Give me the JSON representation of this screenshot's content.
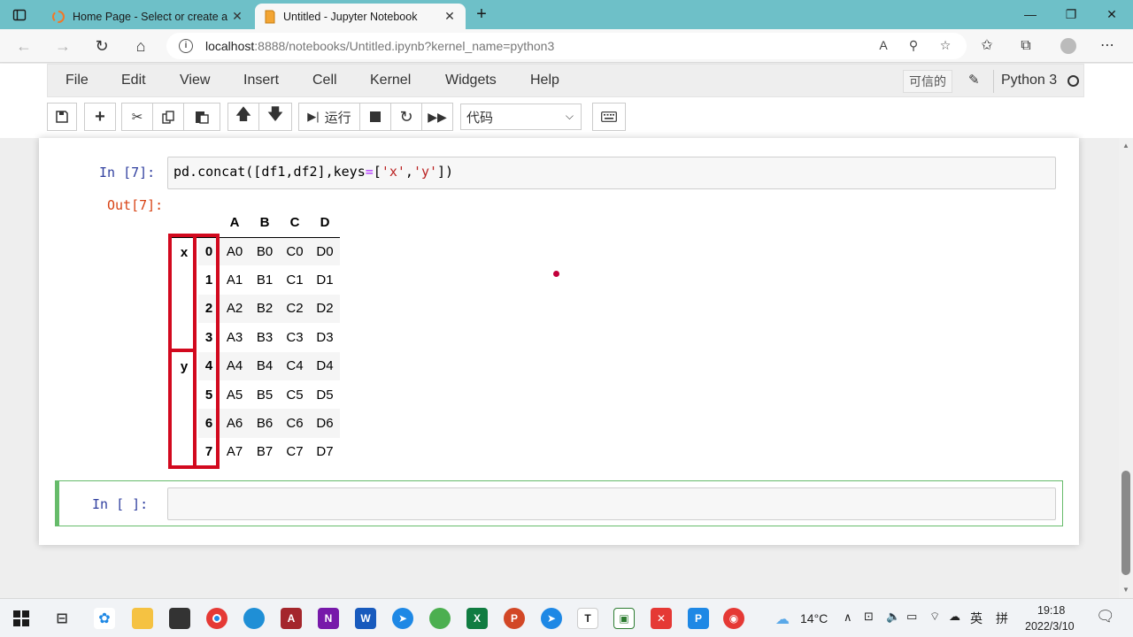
{
  "browser": {
    "tabs": [
      {
        "title": "Home Page - Select or create a n",
        "active": false
      },
      {
        "title": "Untitled - Jupyter Notebook",
        "active": true
      }
    ],
    "url_host": "localhost",
    "url_rest": ":8888/notebooks/Untitled.ipynb?kernel_name=python3"
  },
  "menu": [
    "File",
    "Edit",
    "View",
    "Insert",
    "Cell",
    "Kernel",
    "Widgets",
    "Help"
  ],
  "header": {
    "trusted_label": "可信的",
    "kernel_name": "Python 3"
  },
  "toolbar": {
    "run_label": "运行",
    "cell_type": "代码"
  },
  "cells": {
    "in7_prompt": "In  [7]:",
    "in7_code": {
      "fn": "pd.concat",
      "open": "([df1,df2],",
      "kw": "keys",
      "eq": "=",
      "lb": "[",
      "s1": "'x'",
      "comma": ",",
      "s2": "'y'",
      "close": "])"
    },
    "out7_prompt": "Out[7]:",
    "new_prompt": "In  [  ]:"
  },
  "dataframe": {
    "columns": [
      "A",
      "B",
      "C",
      "D"
    ],
    "outer_index": [
      "x",
      "y"
    ],
    "inner_index": [
      "0",
      "1",
      "2",
      "3",
      "4",
      "5",
      "6",
      "7"
    ],
    "rows": [
      [
        "A0",
        "B0",
        "C0",
        "D0"
      ],
      [
        "A1",
        "B1",
        "C1",
        "D1"
      ],
      [
        "A2",
        "B2",
        "C2",
        "D2"
      ],
      [
        "A3",
        "B3",
        "C3",
        "D3"
      ],
      [
        "A4",
        "B4",
        "C4",
        "D4"
      ],
      [
        "A5",
        "B5",
        "C5",
        "D5"
      ],
      [
        "A6",
        "B6",
        "C6",
        "D6"
      ],
      [
        "A7",
        "B7",
        "C7",
        "D7"
      ]
    ]
  },
  "taskbar": {
    "weather": "14°C",
    "ime_lang": "英",
    "ime_mode": "拼",
    "time": "19:18",
    "date": "2022/3/10"
  },
  "colors": {
    "tabstrip": "#6ec0c8",
    "highlight": "#d2091e",
    "prompt_in": "#303f9f",
    "prompt_out": "#d84315",
    "selected_cell": "#66bb6a"
  }
}
